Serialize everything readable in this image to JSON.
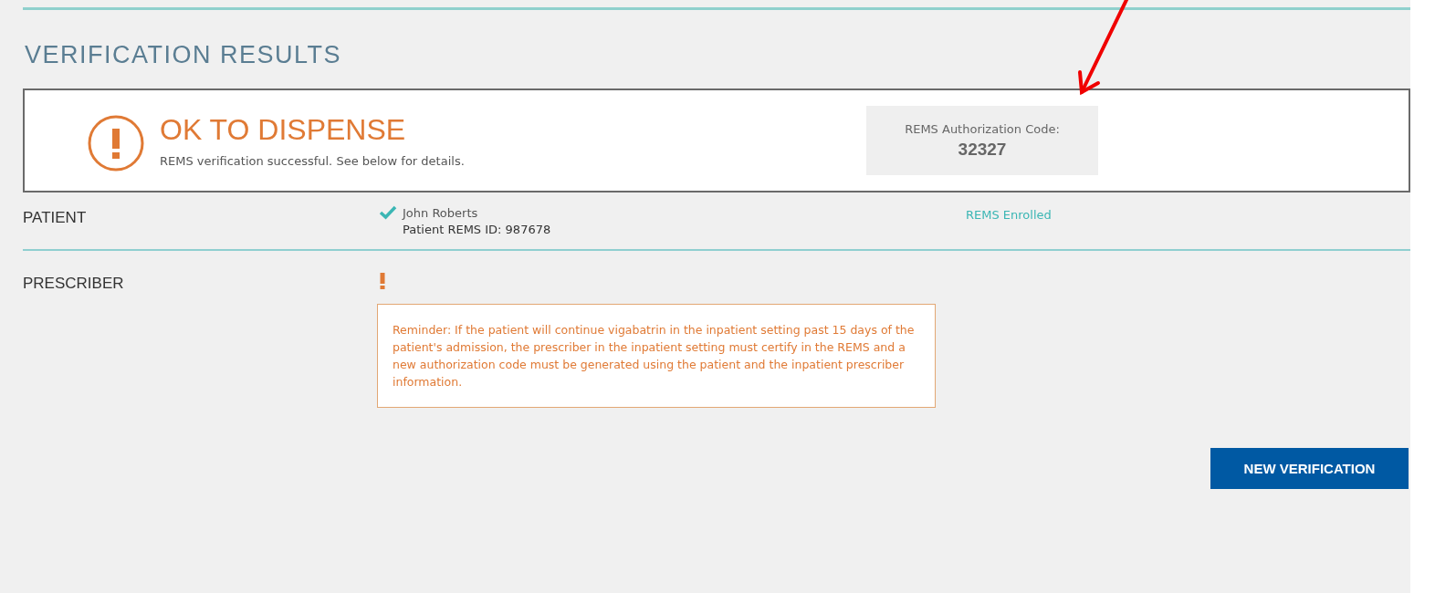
{
  "heading": "VERIFICATION RESULTS",
  "result": {
    "status": "OK TO DISPENSE",
    "message": "REMS verification successful. See below for details.",
    "code_label": "REMS Authorization Code:",
    "code": "32327"
  },
  "sections": [
    {
      "label": "PATIENT",
      "kind": "verified",
      "name": "John Roberts",
      "detail": "Patient REMS ID: 987678",
      "status": "REMS Enrolled"
    },
    {
      "label": "PRESCRIBER",
      "kind": "warning",
      "reminder": "Reminder: If the patient will continue vigabatrin in the inpatient setting past 15 days of the patient's admission, the prescriber in the inpatient setting must certify in the REMS and a new authorization code must be generated using the patient and the inpatient prescriber information."
    }
  ],
  "button": "NEW VERIFICATION"
}
